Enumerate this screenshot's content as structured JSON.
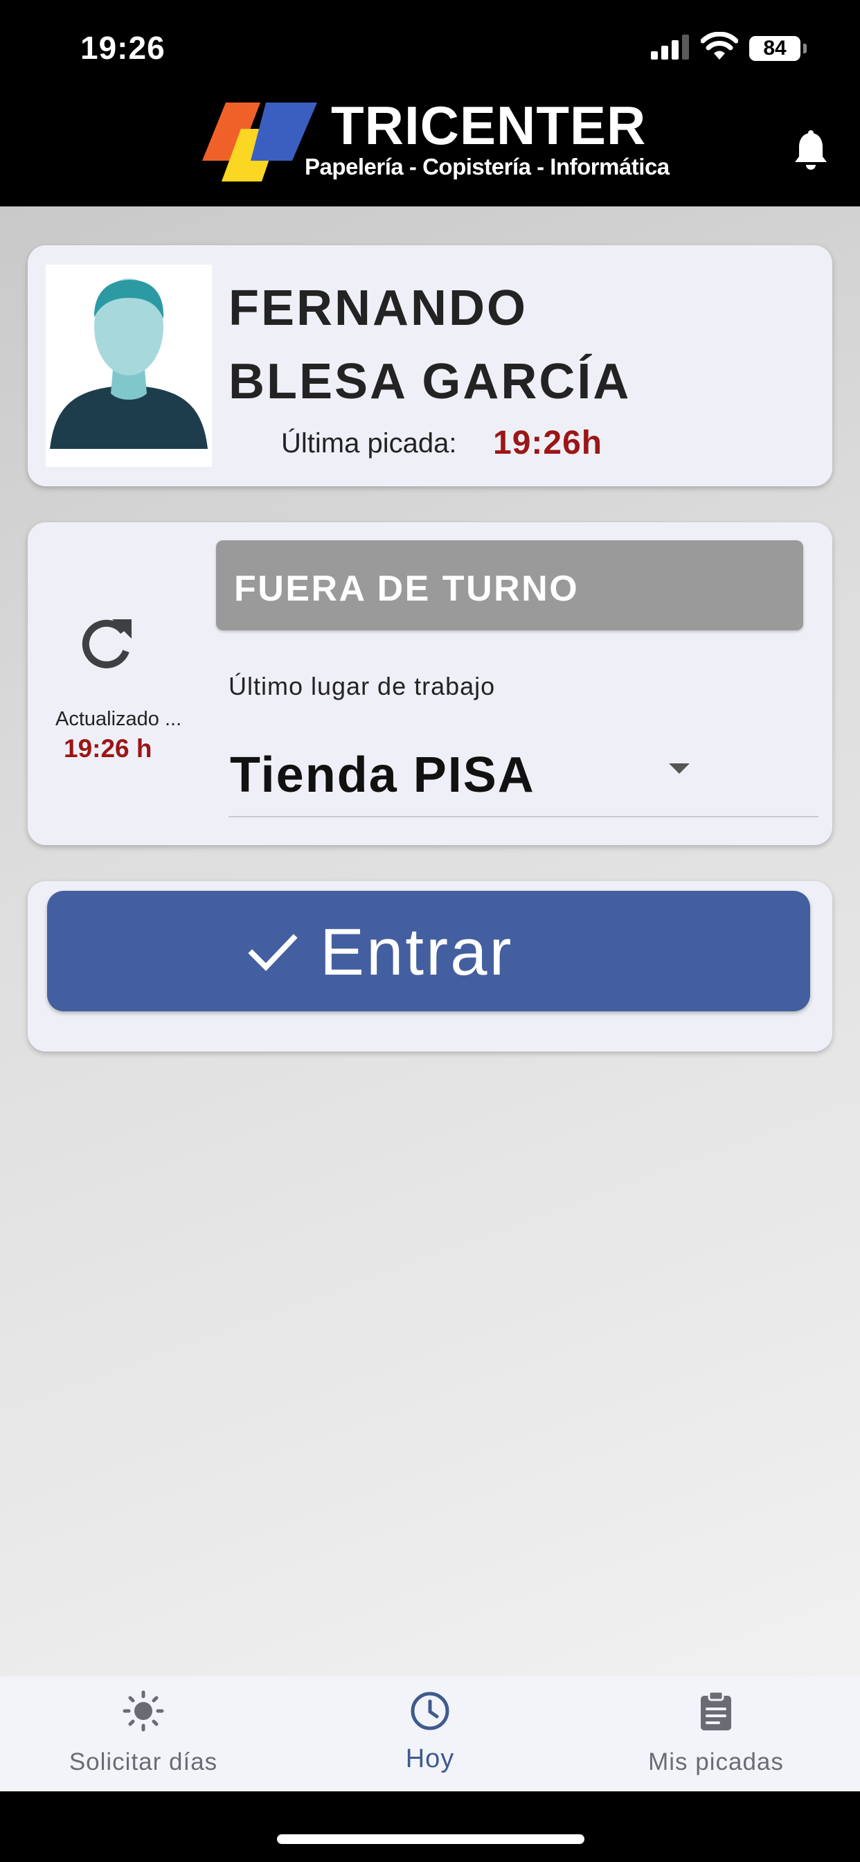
{
  "status_bar": {
    "time": "19:26",
    "battery": "84"
  },
  "header": {
    "brand": "TRICENTER",
    "tagline": "Papelería - Copistería - Informática",
    "logo_colors": [
      "#f0612a",
      "#fbd622",
      "#3b5fc0"
    ]
  },
  "profile": {
    "first_name": "FERNANDO",
    "last_name": "BLESA GARCÍA",
    "last_punch_label": "Última picada:",
    "last_punch_time": "19:26h"
  },
  "status": {
    "updated_label": "Actualizado ...",
    "updated_time": "19:26 h",
    "shift_state": "FUERA DE TURNO",
    "workplace_label": "Último lugar de trabajo",
    "workplace_value": "Tienda PISA"
  },
  "action": {
    "enter_label": "Entrar"
  },
  "nav": {
    "items": [
      {
        "label": "Solicitar días",
        "icon": "sun-icon",
        "active": false
      },
      {
        "label": "Hoy",
        "icon": "clock-icon",
        "active": true
      },
      {
        "label": "Mis picadas",
        "icon": "clipboard-icon",
        "active": false
      }
    ]
  },
  "colors": {
    "accent_red": "#9b1616",
    "primary_button": "#445f9f",
    "status_chip": "#9a9a9a",
    "nav_active": "#3f5b8d"
  }
}
